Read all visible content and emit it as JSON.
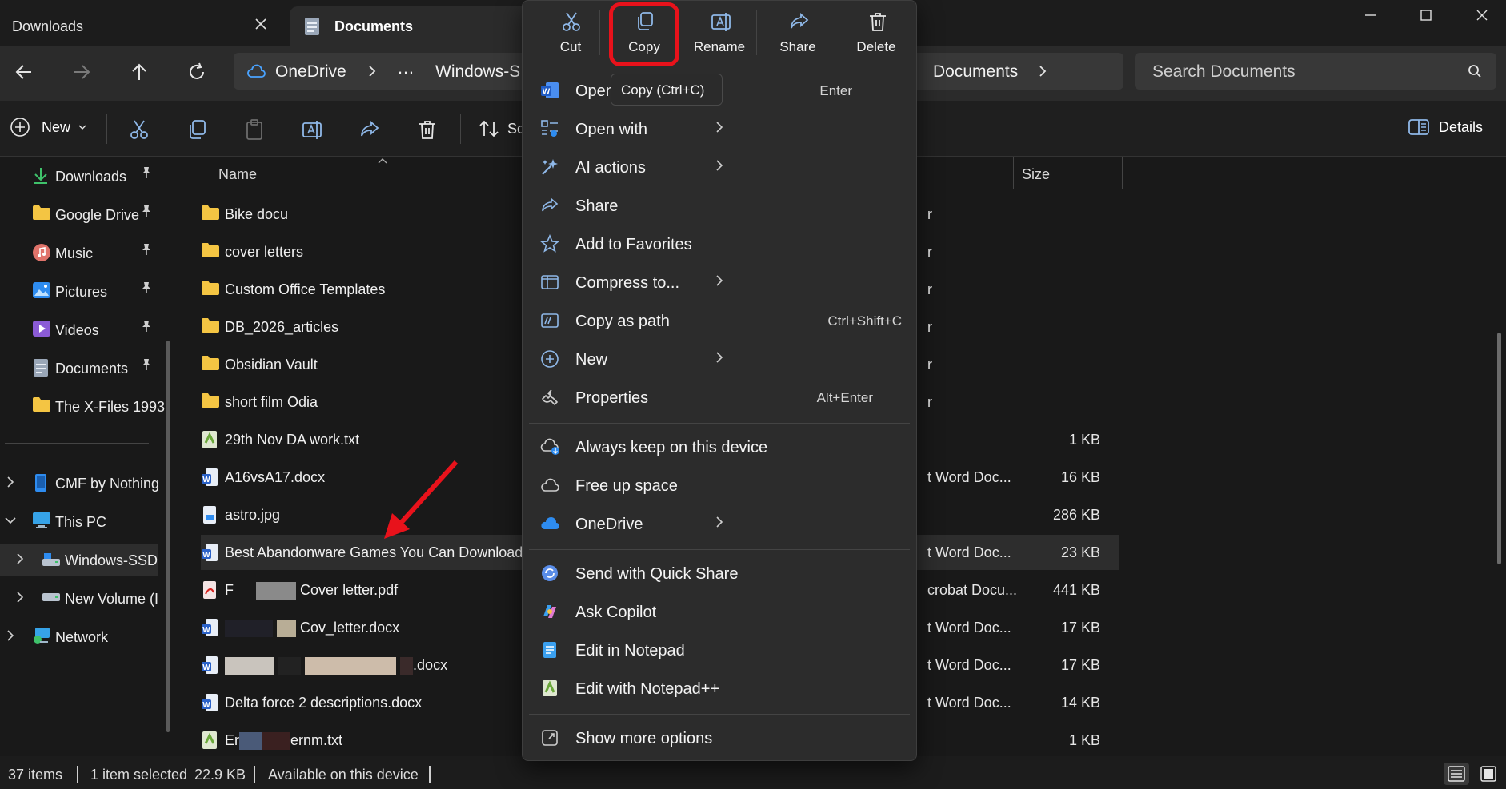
{
  "tabs": {
    "downloads": "Downloads",
    "documents": "Documents"
  },
  "address": {
    "onedrive": "OneDrive",
    "ellipsis": "…",
    "windows_ssd": "Windows-S",
    "documents": "Documents"
  },
  "search": {
    "placeholder": "Search Documents"
  },
  "toolbar": {
    "new_label": "New",
    "sort_label": "Sc",
    "details_label": "Details"
  },
  "sidebar": {
    "items": [
      {
        "label": "Downloads"
      },
      {
        "label": "Google Drive"
      },
      {
        "label": "Music"
      },
      {
        "label": "Pictures"
      },
      {
        "label": "Videos"
      },
      {
        "label": "Documents"
      },
      {
        "label": "The X-Files 1993"
      },
      {
        "label": "CMF by Nothing"
      },
      {
        "label": "This PC"
      },
      {
        "label": "Windows-SSD"
      },
      {
        "label": "New Volume (I"
      },
      {
        "label": "Network"
      }
    ]
  },
  "columns": {
    "name": "Name",
    "size": "Size"
  },
  "files": [
    {
      "name": "Bike docu",
      "type": "r",
      "size": ""
    },
    {
      "name": "cover letters",
      "type": "r",
      "size": ""
    },
    {
      "name": "Custom Office Templates",
      "type": "r",
      "size": ""
    },
    {
      "name": "DB_2026_articles",
      "type": "r",
      "size": ""
    },
    {
      "name": "Obsidian Vault",
      "type": "r",
      "size": ""
    },
    {
      "name": "short film Odia",
      "type": "r",
      "size": ""
    },
    {
      "name": "29th Nov DA work.txt",
      "type": "",
      "size": "1 KB"
    },
    {
      "name": "A16vsA17.docx",
      "type": "t Word Doc...",
      "size": "16 KB"
    },
    {
      "name": "astro.jpg",
      "type": "",
      "size": "286 KB"
    },
    {
      "name": "Best Abandonware Games You Can Download",
      "type": "t Word Doc...",
      "size": "23 KB"
    },
    {
      "name": "Cover letter.pdf",
      "type": "crobat Docu...",
      "size": "441 KB"
    },
    {
      "name": "Cov_letter.docx",
      "type": "t Word Doc...",
      "size": "17 KB"
    },
    {
      "name": ".docx",
      "type": "t Word Doc...",
      "size": "17 KB"
    },
    {
      "name": "Delta force 2 descriptions.docx",
      "type": "t Word Doc...",
      "size": "14 KB"
    },
    {
      "name": "ernm.txt",
      "type": "",
      "size": "1 KB"
    }
  ],
  "file_name_parts": {
    "row10_prefix": "F",
    "row15_prefix": "Er"
  },
  "status": {
    "items": "37 items",
    "selected": "1 item selected",
    "size": "22.9 KB",
    "availability": "Available on this device"
  },
  "menu": {
    "quick": {
      "cut": "Cut",
      "copy": "Copy",
      "rename": "Rename",
      "share": "Share",
      "delete": "Delete"
    },
    "tooltip": "Copy (Ctrl+C)",
    "items": [
      {
        "label": "Open",
        "shortcut": "Enter"
      },
      {
        "label": "Open with",
        "shortcut": ""
      },
      {
        "label": "AI actions",
        "shortcut": ""
      },
      {
        "label": "Share",
        "shortcut": ""
      },
      {
        "label": "Add to Favorites",
        "shortcut": ""
      },
      {
        "label": "Compress to...",
        "shortcut": ""
      },
      {
        "label": "Copy as path",
        "shortcut": "Ctrl+Shift+C"
      },
      {
        "label": "New",
        "shortcut": ""
      },
      {
        "label": "Properties",
        "shortcut": "Alt+Enter"
      },
      {
        "label": "Always keep on this device",
        "shortcut": ""
      },
      {
        "label": "Free up space",
        "shortcut": ""
      },
      {
        "label": "OneDrive",
        "shortcut": ""
      },
      {
        "label": "Send with Quick Share",
        "shortcut": ""
      },
      {
        "label": "Ask Copilot",
        "shortcut": ""
      },
      {
        "label": "Edit in Notepad",
        "shortcut": ""
      },
      {
        "label": "Edit with Notepad++",
        "shortcut": ""
      },
      {
        "label": "Show more options",
        "shortcut": ""
      }
    ]
  },
  "colors": {
    "accent": "#4aa3ff",
    "highlight": "#e8121b",
    "folder": "#f4c543",
    "background": "#191919",
    "menu": "#2c2c2c"
  }
}
